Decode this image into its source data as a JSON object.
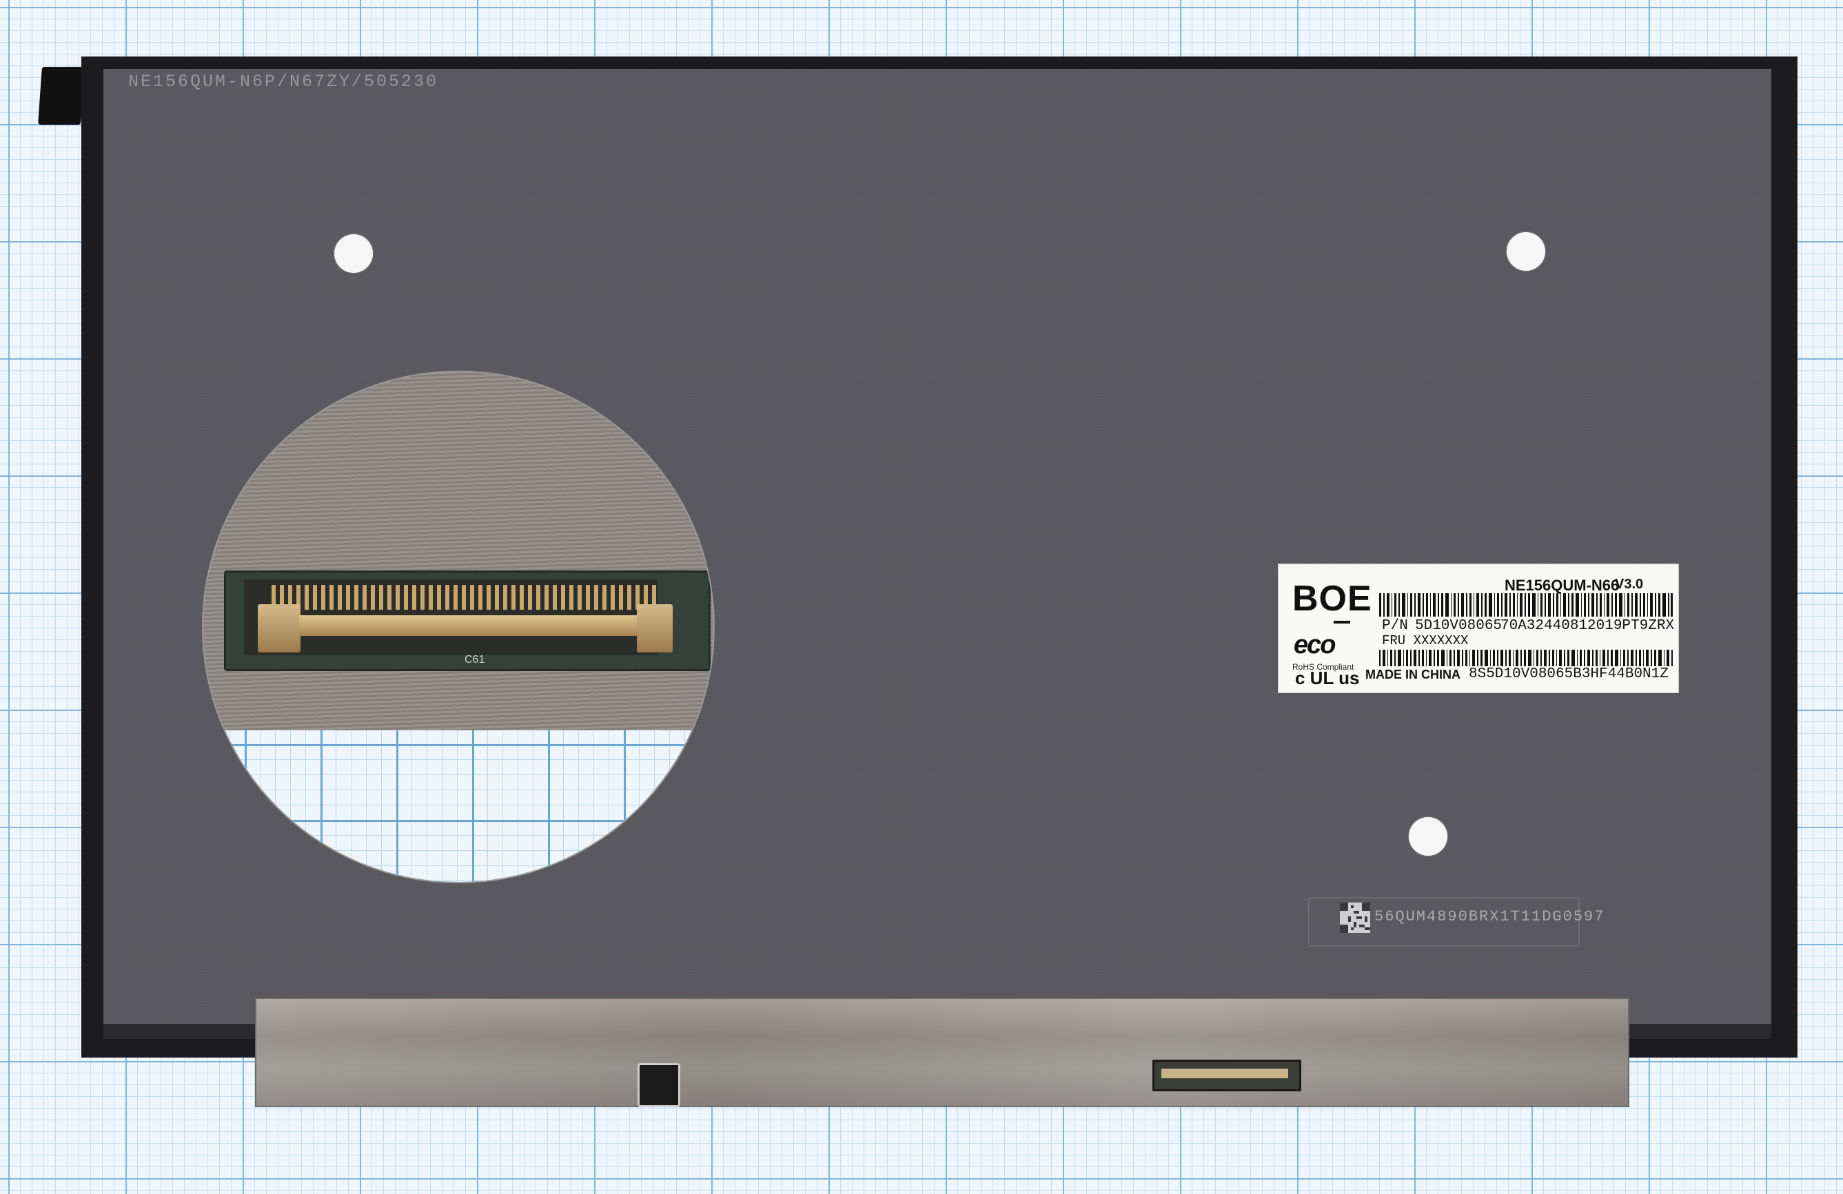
{
  "panel": {
    "serial_top": "NE156QUM-N6P/N67ZY/505230",
    "label": {
      "brand": "BOE",
      "eco_logo": "eco",
      "rohs": "RoHS  Compliant",
      "ul_mark": "c UL us",
      "model": "NE156QUM-N66",
      "version": "V3.0",
      "pn_label": "P/N",
      "pn_value": "5D10V08065",
      "code_1": "70A32440812019PT9ZRX",
      "fru": "FRU XXXXXXX",
      "made_in": "MADE IN CHINA",
      "code_2": "8S5D10V08065B3HF44B0N1Z"
    },
    "lot_code": "56QUM4890BRX1T11DG0597",
    "zoom_silkscreen": "C61"
  },
  "colors": {
    "grid_paper": "#eef6fb",
    "panel_back": "#58585d",
    "panel_frame": "#1c1c1f",
    "fpc": "#9b9793",
    "label": "#f9f9f7"
  },
  "icons": [
    "mount-hole",
    "qr-code",
    "barcode",
    "connector"
  ]
}
